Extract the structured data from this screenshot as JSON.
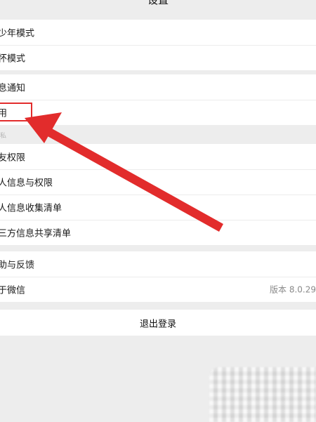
{
  "nav": {
    "title": "设置"
  },
  "groups": [
    {
      "items": [
        {
          "label": "少年模式"
        },
        {
          "label": "怀模式"
        }
      ]
    },
    {
      "items": [
        {
          "label": "息通知"
        },
        {
          "label": "用"
        }
      ]
    },
    {
      "header": "私",
      "items": [
        {
          "label": "友权限"
        },
        {
          "label": "人信息与权限"
        },
        {
          "label": "人信息收集清单"
        },
        {
          "label": "三方信息共享清单"
        }
      ]
    },
    {
      "items": [
        {
          "label": "助与反馈"
        },
        {
          "label": "于微信",
          "value": "版本 8.0.29"
        }
      ]
    }
  ],
  "logout": {
    "label": "退出登录"
  },
  "colors": {
    "annotation": "#e22c2c",
    "background": "#ededed",
    "card": "#ffffff"
  }
}
